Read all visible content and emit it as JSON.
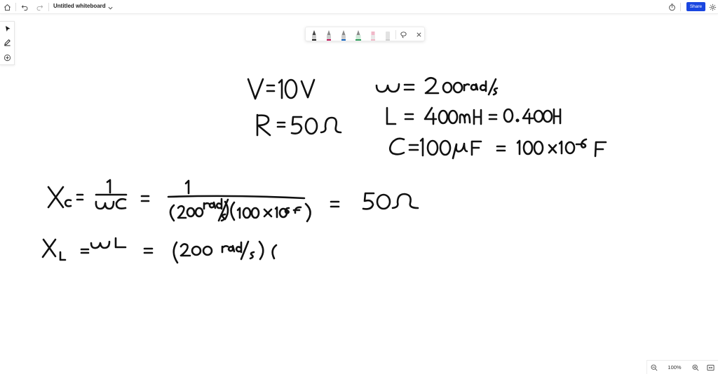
{
  "app": {
    "title": "Untitled whiteboard",
    "share_label": "Share"
  },
  "icons": {
    "home": "home-icon",
    "undo": "undo-icon",
    "redo": "redo-icon",
    "chevron": "chevron-down-icon",
    "timer": "timer-icon",
    "settings": "gear-icon",
    "select": "pointer-icon",
    "pen": "pen-icon",
    "add": "add-icon",
    "lasso": "lasso-icon",
    "close": "close-icon",
    "zoom_out": "zoom-out-icon",
    "zoom_in": "zoom-in-icon",
    "fit": "fit-screen-icon"
  },
  "colors": {
    "accent": "#1a46e0",
    "pen_black": "#222222",
    "pen_red": "#c2185b",
    "pen_blue": "#1565c0",
    "pen_green": "#2e9e5b",
    "highlighter": "#f0b8c8",
    "eraser": "#cfcfcf"
  },
  "zoom": {
    "level": "100%"
  },
  "whiteboard": {
    "ink_lines": [
      "V=10V",
      "ω = 200 rad/s",
      "R = 50Ω",
      "L = 400mH = 0.400 H",
      "C = 100 μF = 100 × 10⁻⁶ F",
      "Xc = 1/(ωC) = 1/((200 rad/s)(100×10⁻⁶ F)) = 50Ω",
      "XL = ωL = (200 rad/s)("
    ]
  }
}
